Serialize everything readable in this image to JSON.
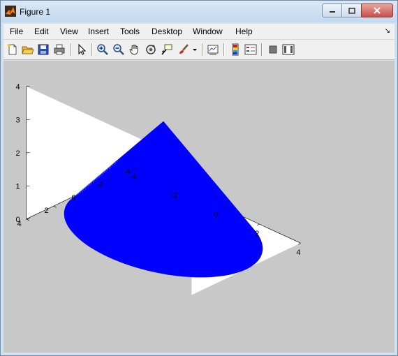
{
  "window": {
    "title": "Figure 1"
  },
  "menu": [
    "File",
    "Edit",
    "View",
    "Insert",
    "Tools",
    "Desktop",
    "Window",
    "Help"
  ],
  "toolbar": [
    {
      "name": "new-figure-icon"
    },
    {
      "name": "open-file-icon"
    },
    {
      "name": "save-icon"
    },
    {
      "name": "print-icon"
    },
    {
      "name": "edit-plot-arrow-icon"
    },
    {
      "name": "zoom-in-icon"
    },
    {
      "name": "zoom-out-icon"
    },
    {
      "name": "pan-hand-icon"
    },
    {
      "name": "rotate-3d-icon"
    },
    {
      "name": "data-cursor-icon"
    },
    {
      "name": "brush-icon"
    },
    {
      "name": "brush-dropdown-icon"
    },
    {
      "name": "link-plot-icon"
    },
    {
      "name": "colorbar-icon"
    },
    {
      "name": "legend-icon"
    },
    {
      "name": "hide-plot-tools-icon"
    },
    {
      "name": "show-plot-tools-icon"
    }
  ],
  "chart_data": {
    "type": "surface",
    "title": "",
    "xlabel": "",
    "ylabel": "",
    "zlabel": "",
    "xlim": [
      -4,
      4
    ],
    "ylim": [
      -4,
      4
    ],
    "zlim": [
      0,
      4
    ],
    "x_ticks": [
      "-4",
      "-2",
      "0",
      "2",
      "4"
    ],
    "y_ticks": [
      "-4",
      "-2",
      "0",
      "2",
      "4"
    ],
    "z_ticks": [
      "0",
      "1",
      "2",
      "3",
      "4"
    ],
    "surface": {
      "shape": "cone",
      "base_radius": 4,
      "apex_height": 3.3,
      "color": "#0000ff"
    },
    "axes_background": "#ffffff",
    "figure_background": "#c8c8c8"
  }
}
